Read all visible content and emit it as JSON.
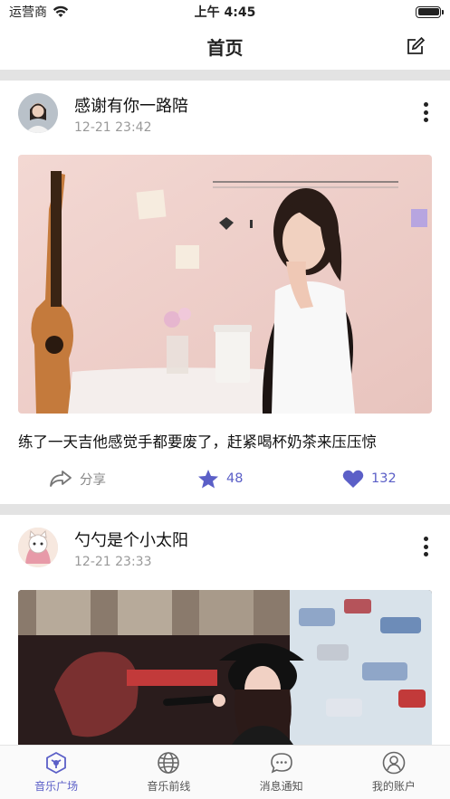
{
  "status_bar": {
    "carrier": "运营商",
    "time": "上午 4:45"
  },
  "nav": {
    "title": "首页",
    "edit_icon": "edit-icon"
  },
  "posts": [
    {
      "name": "感谢有你一路陪",
      "time": "12-21 23:42",
      "text": "练了一天吉他感觉手都要废了，赶紧喝杯奶茶来压压惊",
      "share_label": "分享",
      "stars": "48",
      "likes": "132",
      "image_alt": "girl sitting at table with guitar and milk tea"
    },
    {
      "name": "勺勺是个小太阳",
      "time": "12-21 23:33",
      "image_alt": "girl singing into microphone on stage"
    }
  ],
  "tabs": [
    {
      "label": "音乐广场",
      "icon": "music-square-icon",
      "active": true
    },
    {
      "label": "音乐前线",
      "icon": "globe-icon",
      "active": false
    },
    {
      "label": "消息通知",
      "icon": "message-icon",
      "active": false
    },
    {
      "label": "我的账户",
      "icon": "account-icon",
      "active": false
    }
  ],
  "colors": {
    "accent": "#5b5fc7",
    "divider": "#e3e3e3",
    "muted": "#999999"
  }
}
